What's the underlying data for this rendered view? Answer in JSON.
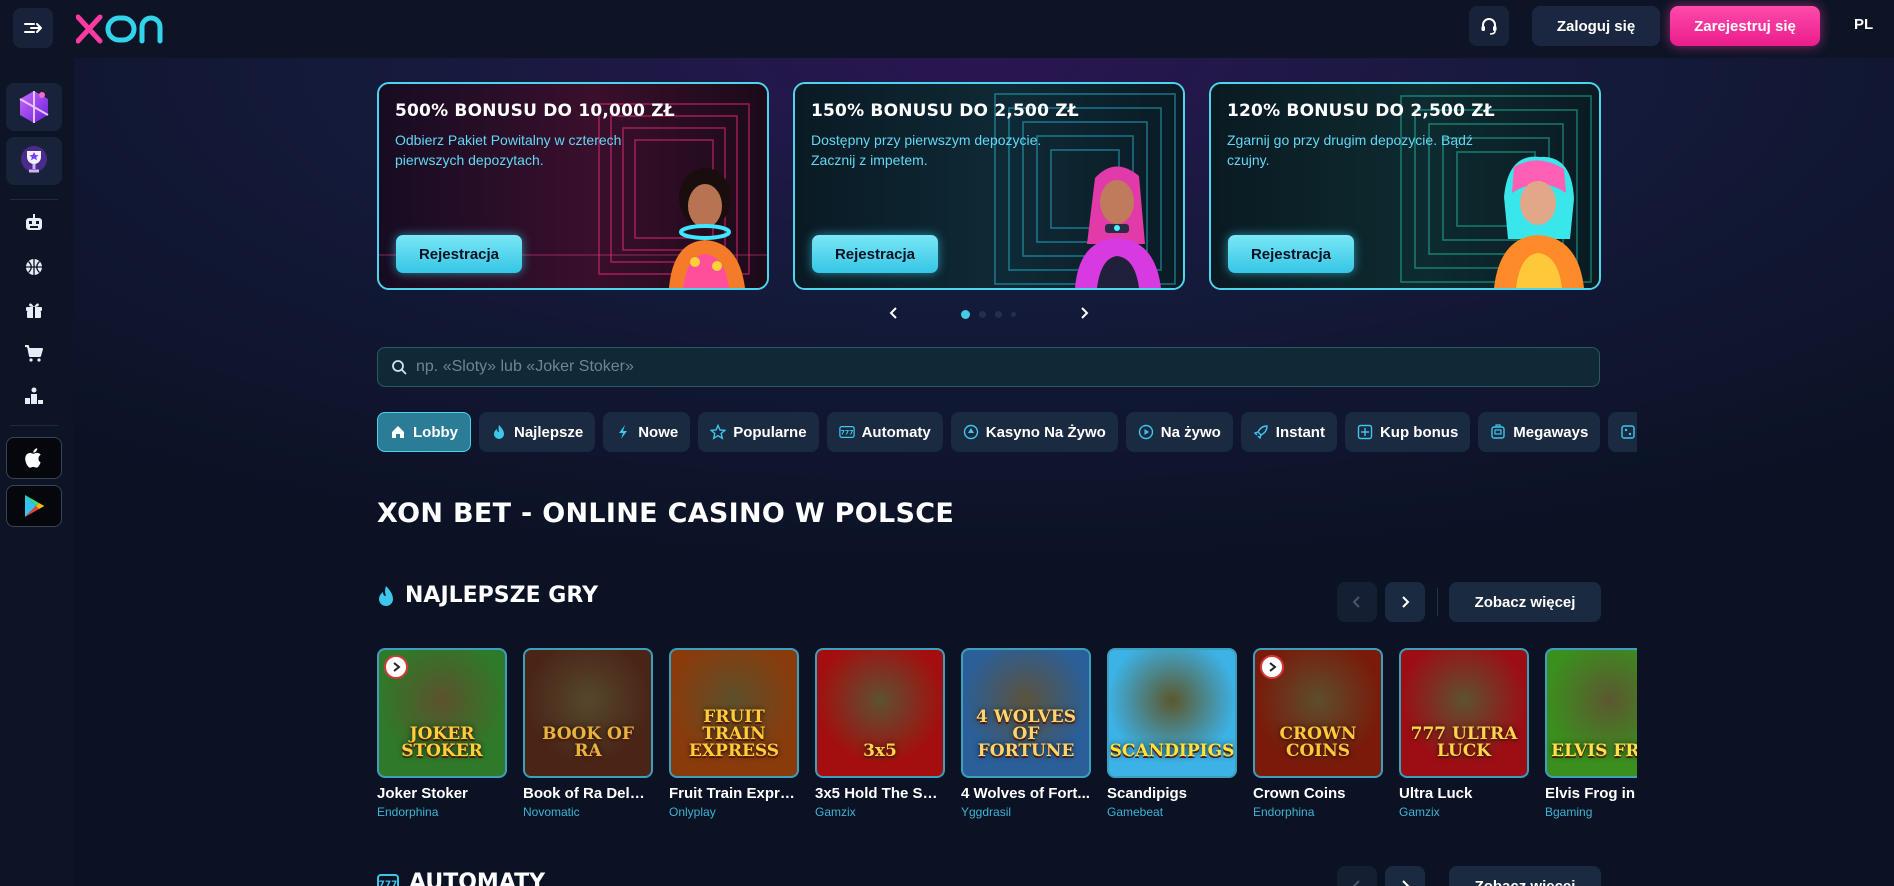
{
  "header": {
    "logo_text": "xon",
    "login_label": "Zaloguj się",
    "register_label": "Zarejestruj się",
    "language": "PL"
  },
  "sidebar": {
    "icons": [
      "bonus-box-icon",
      "trophy-cup-icon",
      "robot-icon",
      "basketball-icon",
      "gift-icon",
      "cart-icon",
      "podium-icon"
    ],
    "stores": [
      "apple-icon",
      "google-play-icon"
    ]
  },
  "banners": [
    {
      "title": "500% BONUSU DO 10,000 ZŁ",
      "subtitle": "Odbierz Pakiet Powitalny w czterech pierwszych depozytach.",
      "button": "Rejestracja",
      "accent": "#e0286f"
    },
    {
      "title": "150% BONUSU DO 2,500 ZŁ",
      "subtitle": "Dostępny przy pierwszym depozycie. Zacznij z impetem.",
      "button": "Rejestracja",
      "accent": "#23a9c6"
    },
    {
      "title": "120% BONUSU DO 2,500 ZŁ",
      "subtitle": "Zgarnij go przy drugim depozycie. Bądź czujny.",
      "button": "Rejestracja",
      "accent": "#23a9c6"
    }
  ],
  "carousel": {
    "dots": 4,
    "active_dot": 1
  },
  "search": {
    "placeholder": "np. «Sloty» lub «Joker Stoker»",
    "value": ""
  },
  "tabs": [
    {
      "label": "Lobby",
      "icon": "home-icon",
      "active": true
    },
    {
      "label": "Najlepsze",
      "icon": "flame-icon",
      "active": false
    },
    {
      "label": "Nowe",
      "icon": "lightning-icon",
      "active": false
    },
    {
      "label": "Popularne",
      "icon": "star-icon",
      "active": false
    },
    {
      "label": "Automaty",
      "icon": "777-icon",
      "active": false
    },
    {
      "label": "Kasyno Na Żywo",
      "icon": "casino-chip-icon",
      "active": false
    },
    {
      "label": "Na żywo",
      "icon": "play-circle-icon",
      "active": false
    },
    {
      "label": "Instant",
      "icon": "rocket-icon",
      "active": false
    },
    {
      "label": "Kup bonus",
      "icon": "bonus-buy-icon",
      "active": false
    },
    {
      "label": "Megaways",
      "icon": "slot-machine-icon",
      "active": false
    },
    {
      "label": "",
      "icon": "dice-icon",
      "active": false
    }
  ],
  "page_title": "XON BET - ONLINE CASINO W POLSCE",
  "sections": [
    {
      "title": "NAJLEPSZE GRY",
      "icon": "flame-icon",
      "see_more": "Zobacz więcej"
    },
    {
      "title": "AUTOMATY",
      "icon": "777-icon",
      "see_more": "Zobacz więcej"
    }
  ],
  "games": [
    {
      "name": "Joker Stoker",
      "provider": "Endorphina",
      "thumb_text": "JOKER STOKER",
      "bg": "#2e7a2a",
      "fg": "#ffd03a",
      "badge": true
    },
    {
      "name": "Book of Ra Delux...",
      "provider": "Novomatic",
      "thumb_text": "BOOK OF RA",
      "bg": "#4a2416",
      "fg": "#e8b33f",
      "badge": false
    },
    {
      "name": "Fruit Train Expre...",
      "provider": "Onlyplay",
      "thumb_text": "FRUIT TRAIN EXPRESS",
      "bg": "#8a3b0c",
      "fg": "#ffcd3a",
      "badge": false
    },
    {
      "name": "3x5 Hold The Spin",
      "provider": "Gamzix",
      "thumb_text": "3x5",
      "bg": "#a40e0e",
      "fg": "#ffd24a",
      "badge": false
    },
    {
      "name": "4 Wolves of Fort...",
      "provider": "Yggdrasil",
      "thumb_text": "4 WOLVES OF FORTUNE",
      "bg": "#2a5f9a",
      "fg": "#ffd46a",
      "badge": false
    },
    {
      "name": "Scandipigs",
      "provider": "Gamebeat",
      "thumb_text": "SCANDIPIGS",
      "bg": "#3cb2e6",
      "fg": "#ffe23a",
      "badge": false
    },
    {
      "name": "Crown Coins",
      "provider": "Endorphina",
      "thumb_text": "CROWN COINS",
      "bg": "#7a1a0a",
      "fg": "#ffc83a",
      "badge": true
    },
    {
      "name": "Ultra Luck",
      "provider": "Gamzix",
      "thumb_text": "777 ULTRA LUCK",
      "bg": "#9d0d14",
      "fg": "#ffd34a",
      "badge": false
    },
    {
      "name": "Elvis Frog in V...",
      "provider": "Bgaming",
      "thumb_text": "ELVIS FROG",
      "bg": "#3b8f1e",
      "fg": "#ffe14a",
      "badge": false
    }
  ]
}
